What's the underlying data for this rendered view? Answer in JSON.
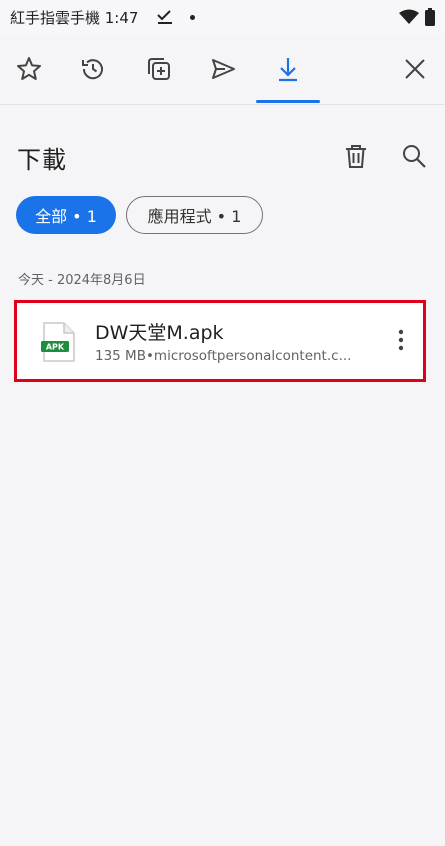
{
  "status_bar": {
    "carrier_time": "紅手指雲手機 1:47",
    "icons": [
      "check-download-icon",
      "dot-icon",
      "wifi-icon",
      "battery-icon"
    ]
  },
  "toolbar": {
    "tabs": [
      {
        "name": "bookmarks",
        "icon": "star-icon"
      },
      {
        "name": "history",
        "icon": "history-icon"
      },
      {
        "name": "tabs",
        "icon": "add-tab-icon"
      },
      {
        "name": "send",
        "icon": "send-icon"
      },
      {
        "name": "downloads",
        "icon": "download-icon",
        "active": true
      }
    ],
    "close_icon": "close-icon",
    "accent_color": "#1a73e8"
  },
  "header": {
    "title": "下載",
    "delete_icon": "trash-icon",
    "search_icon": "search-icon"
  },
  "filters": {
    "chips": [
      {
        "label": "全部 • 1",
        "selected": true
      },
      {
        "label": "應用程式 • 1",
        "selected": false
      }
    ]
  },
  "downloads": {
    "date_header": "今天 - 2024年8月6日",
    "items": [
      {
        "file_name": "DW天堂M.apk",
        "meta": "135 MB•microsoftpersonalcontent.c...",
        "icon_label": "APK",
        "highlight_color": "#e0001a"
      }
    ]
  }
}
